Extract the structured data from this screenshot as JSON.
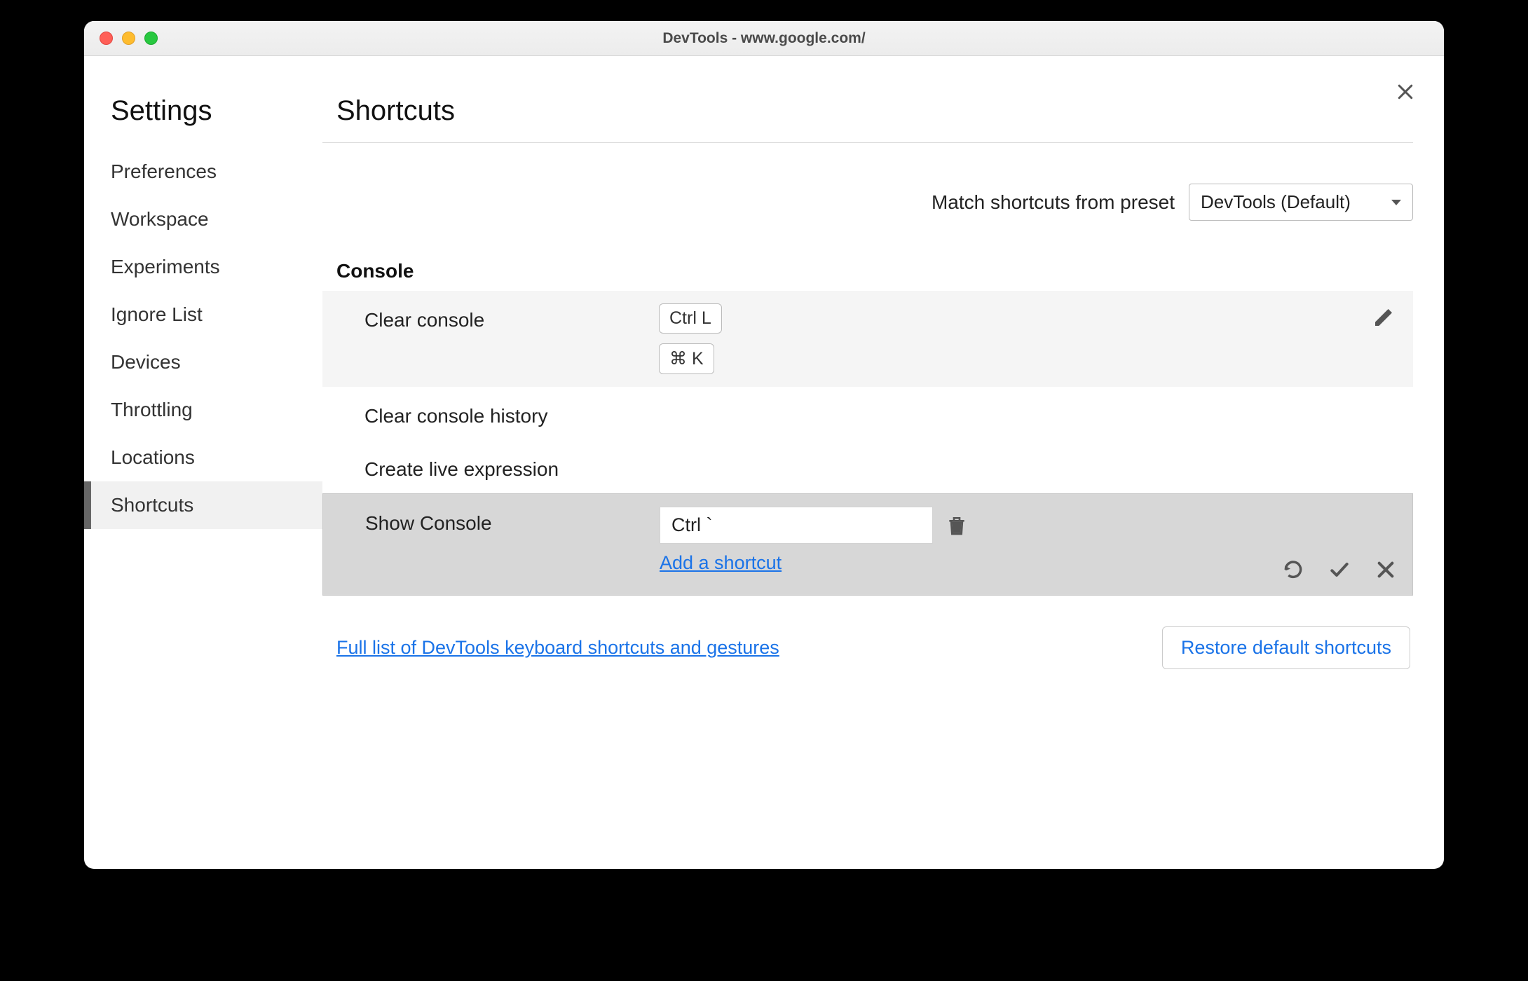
{
  "window": {
    "title": "DevTools - www.google.com/"
  },
  "sidebar": {
    "title": "Settings",
    "items": [
      {
        "label": "Preferences"
      },
      {
        "label": "Workspace"
      },
      {
        "label": "Experiments"
      },
      {
        "label": "Ignore List"
      },
      {
        "label": "Devices"
      },
      {
        "label": "Throttling"
      },
      {
        "label": "Locations"
      },
      {
        "label": "Shortcuts",
        "active": true
      }
    ]
  },
  "main": {
    "heading": "Shortcuts",
    "preset": {
      "label": "Match shortcuts from preset",
      "value": "DevTools (Default)"
    },
    "section": {
      "title": "Console",
      "rows": [
        {
          "label": "Clear console",
          "keys": [
            "Ctrl L",
            "⌘ K"
          ]
        },
        {
          "label": "Clear console history"
        },
        {
          "label": "Create live expression"
        },
        {
          "label": "Show Console",
          "editing": true,
          "input_value": "Ctrl `",
          "add_link": "Add a shortcut"
        }
      ]
    },
    "footer": {
      "link": "Full list of DevTools keyboard shortcuts and gestures",
      "restore": "Restore default shortcuts"
    }
  }
}
